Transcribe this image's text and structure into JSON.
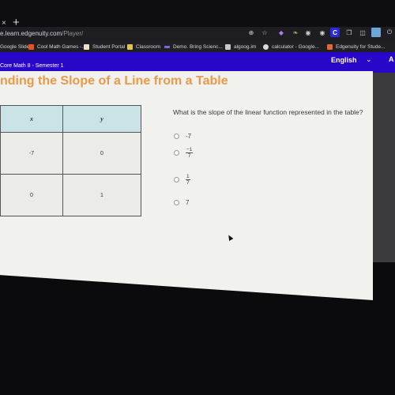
{
  "browser": {
    "tab_close": "×",
    "new_tab": "+",
    "url_host": "e.learn.edgenuity.com",
    "url_path": "/Player/",
    "toolbar_icons": [
      "zoom-icon",
      "star-icon",
      "extension-purple-icon",
      "extension-leaf-icon",
      "extension-shield-icon",
      "extension-shield-2-icon",
      "extension-c-icon",
      "extension-copy-icon",
      "extension-dict-icon",
      "extension-square-icon",
      "power-icon"
    ],
    "bookmarks": [
      {
        "label": "Google Slides",
        "icon": "slides-icon",
        "color": "#f4b400"
      },
      {
        "label": "Cool Math Games -...",
        "icon": "coolmath-icon",
        "color": "#e2542c"
      },
      {
        "label": "Student Portal",
        "icon": "portal-icon",
        "color": "#e8e3c9"
      },
      {
        "label": "Classroom",
        "icon": "classroom-icon",
        "color": "#e3c640"
      },
      {
        "label": "Demo. Bring Scienc...",
        "icon": "demo-icon",
        "color": "#7a6dd8"
      },
      {
        "label": "algoog.im",
        "icon": "algoog-icon",
        "color": "#c9c9c9"
      },
      {
        "label": "calculator - Google...",
        "icon": "google-icon",
        "color": "#d9d9d9"
      },
      {
        "label": "Edgenuity for Stude...",
        "icon": "edgenuity-icon",
        "color": "#e06a3a"
      }
    ]
  },
  "header": {
    "course": "Core Math 8 - Semester 1",
    "language": "English",
    "account_initial": "A",
    "bg_color": "#2a07c8"
  },
  "lesson": {
    "title": "nding the Slope of a Line from a Table",
    "title_color": "#e79a4a"
  },
  "table": {
    "headers": [
      "x",
      "y"
    ],
    "rows": [
      [
        "-7",
        "0"
      ],
      [
        "0",
        "1"
      ]
    ]
  },
  "question": {
    "text": "What is the slope of the linear function represented in the table?",
    "options": [
      {
        "label": "-7"
      },
      {
        "num": "−1",
        "den": "7"
      },
      {
        "num": "1",
        "den": "7"
      },
      {
        "label": "7"
      }
    ]
  }
}
